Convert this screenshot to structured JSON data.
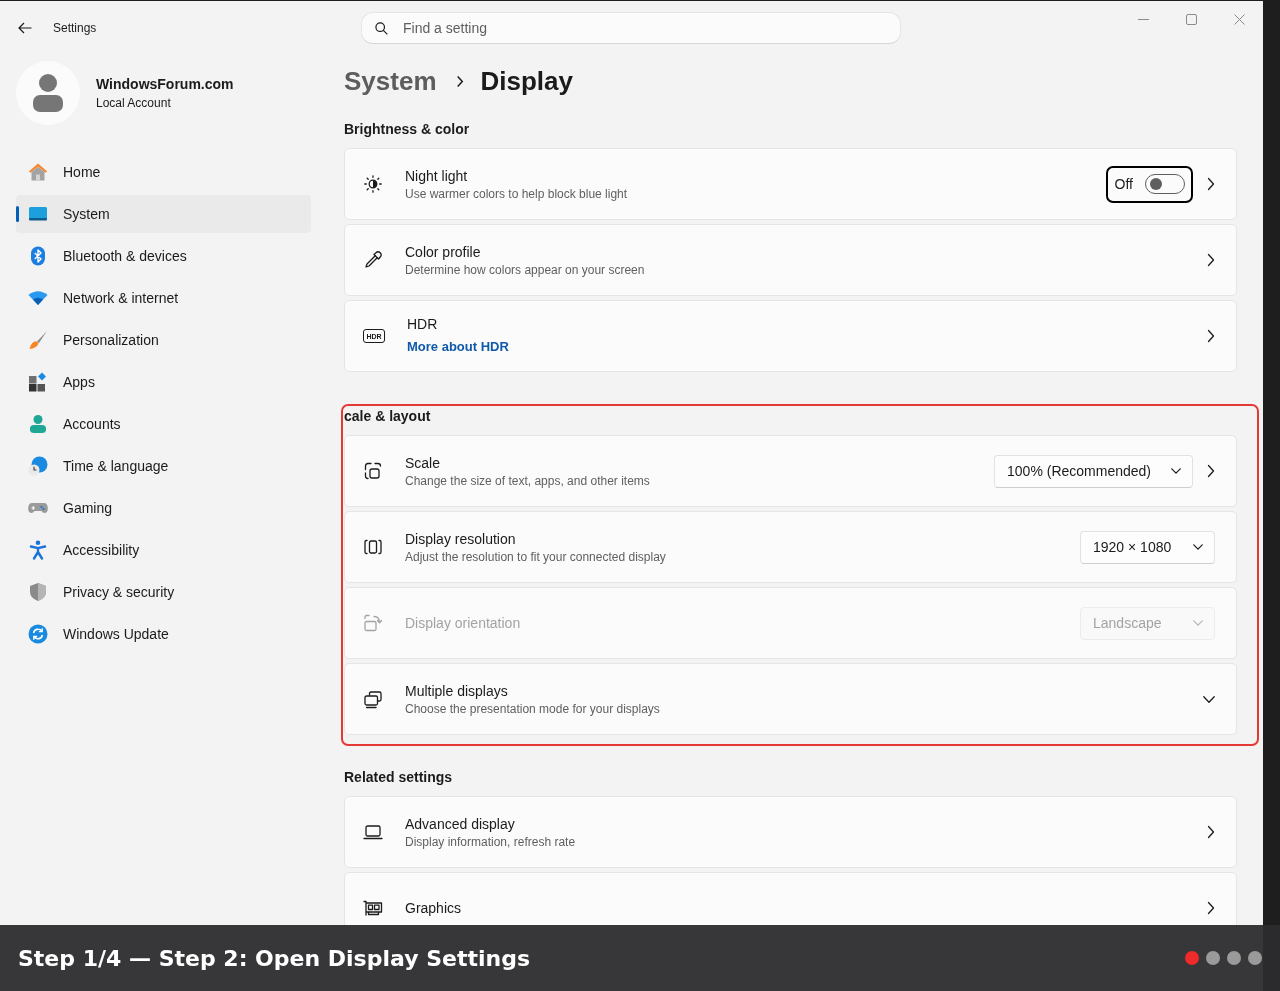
{
  "window": {
    "title": "Settings"
  },
  "profile": {
    "name": "WindowsForum.com",
    "account_type": "Local Account"
  },
  "sidebar": {
    "items": [
      {
        "label": "Home",
        "selected": false
      },
      {
        "label": "System",
        "selected": true
      },
      {
        "label": "Bluetooth & devices",
        "selected": false
      },
      {
        "label": "Network & internet",
        "selected": false
      },
      {
        "label": "Personalization",
        "selected": false
      },
      {
        "label": "Apps",
        "selected": false
      },
      {
        "label": "Accounts",
        "selected": false
      },
      {
        "label": "Time & language",
        "selected": false
      },
      {
        "label": "Gaming",
        "selected": false
      },
      {
        "label": "Accessibility",
        "selected": false
      },
      {
        "label": "Privacy & security",
        "selected": false
      },
      {
        "label": "Windows Update",
        "selected": false
      }
    ]
  },
  "search": {
    "placeholder": "Find a setting"
  },
  "breadcrumb": [
    "System",
    "Display"
  ],
  "sections": [
    {
      "heading": "Brightness & color",
      "highlighted": false,
      "rows": [
        {
          "kind": "toggle",
          "title": "Night light",
          "subtitle": "Use warmer colors to help block blue light",
          "state_label": "Off",
          "on": false,
          "focused": true,
          "navigates": true,
          "disabled": false
        },
        {
          "kind": "plain",
          "title": "Color profile",
          "subtitle": "Determine how colors appear on your screen",
          "navigates": true,
          "disabled": false
        },
        {
          "kind": "plain",
          "title": "HDR",
          "icon_label": "HDR",
          "link": "More about HDR",
          "navigates": true,
          "disabled": false
        }
      ]
    },
    {
      "heading": "cale & layout",
      "highlighted": true,
      "rows": [
        {
          "kind": "dropdown",
          "title": "Scale",
          "subtitle": "Change the size of text, apps, and other items",
          "value": "100% (Recommended)",
          "navigates": true,
          "disabled": false
        },
        {
          "kind": "dropdown",
          "title": "Display resolution",
          "subtitle": "Adjust the resolution to fit your connected display",
          "value": "1920 × 1080",
          "navigates": false,
          "disabled": false
        },
        {
          "kind": "dropdown",
          "title": "Display orientation",
          "value": "Landscape",
          "navigates": false,
          "disabled": true
        },
        {
          "kind": "expander",
          "title": "Multiple displays",
          "subtitle": "Choose the presentation mode for your displays",
          "expanded": false,
          "navigates": false,
          "disabled": false
        }
      ]
    },
    {
      "heading": "Related settings",
      "highlighted": false,
      "rows": [
        {
          "kind": "plain",
          "title": "Advanced display",
          "subtitle": "Display information, refresh rate",
          "navigates": true,
          "disabled": false
        },
        {
          "kind": "plain",
          "title": "Graphics",
          "navigates": true,
          "disabled": false
        }
      ]
    }
  ],
  "caption": {
    "text": "Step 1/4 — Step 2: Open Display Settings",
    "steps": [
      {
        "selected": true
      },
      {
        "selected": false
      },
      {
        "selected": false
      },
      {
        "selected": false
      }
    ]
  }
}
